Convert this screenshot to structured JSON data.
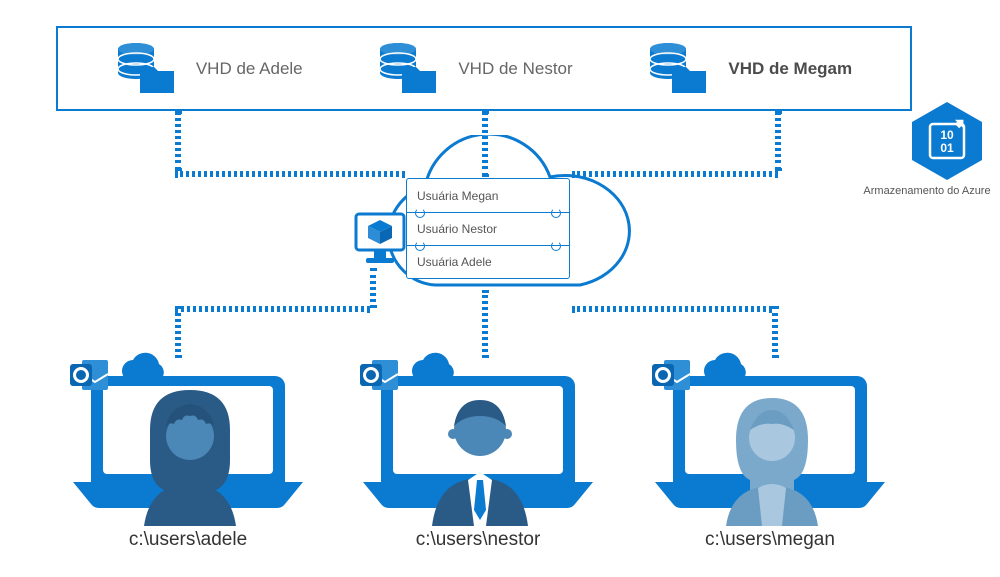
{
  "colors": {
    "primary": "#0b7ad1",
    "dark": "#2c5f8d",
    "mid": "#5b98c7",
    "gray": "#7a99b0"
  },
  "storage": {
    "vhd1": "VHD de Adele",
    "vhd2": "VHD de Nestor",
    "vhd3": "VHD de Megam"
  },
  "azure_label": "Armazenamento do Azure",
  "cloud_users": {
    "row1": "Usuária Megan",
    "row2": "Usuário Nestor",
    "row3": "Usuária Adele"
  },
  "paths": {
    "p1": "c:\\users\\adele",
    "p2": "c:\\users\\nestor",
    "p3": "c:\\users\\megan"
  }
}
